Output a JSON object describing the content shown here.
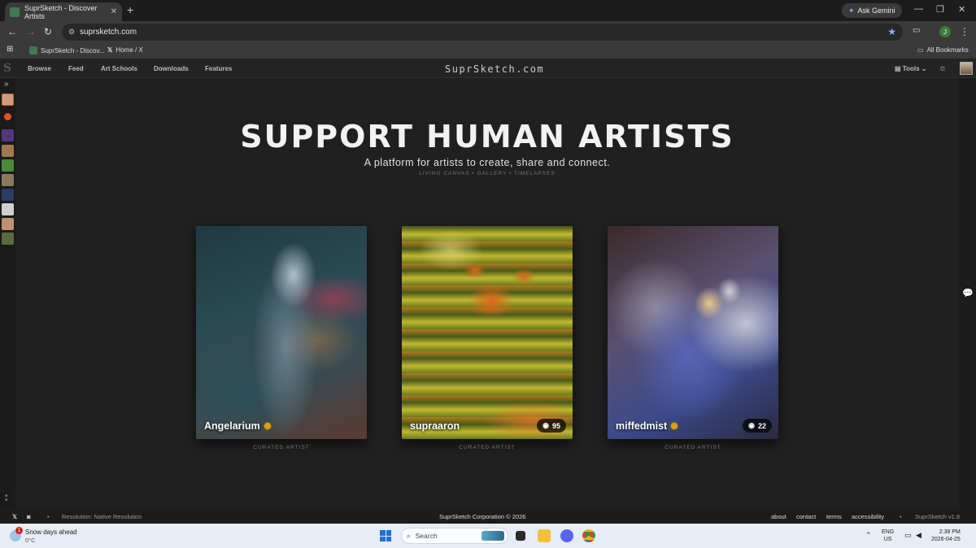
{
  "browser": {
    "tab_title": "SuprSketch - Discover Artists",
    "tab_close": "✕",
    "new_tab": "+",
    "ask_gemini": "Ask Gemini",
    "url": "suprsketch.com",
    "profile_initial": "J",
    "bookmarks": [
      {
        "label": "SuprSketch - Discov..."
      },
      {
        "label": "Home / X"
      }
    ],
    "all_bookmarks": "All Bookmarks"
  },
  "site_nav": {
    "links": [
      "Browse",
      "Feed",
      "Art Schools",
      "Downloads",
      "Features"
    ],
    "brand": "SuprSketch.com",
    "tools": "Tools"
  },
  "hero": {
    "title": "SUPPORT HUMAN ARTISTS",
    "subtitle": "A platform for artists to create, share and connect.",
    "links": "LIVING CANVAS  •  GALLERY  •  TIMELAPSES"
  },
  "cards": [
    {
      "name": "Angelarium",
      "verified": true,
      "views": null,
      "caption": "CURATED ARTIST"
    },
    {
      "name": "supraaron",
      "verified": false,
      "views": "95",
      "caption": "CURATED ARTIST"
    },
    {
      "name": "miffedmist",
      "verified": true,
      "views": "22",
      "caption": "CURATED ARTIST"
    }
  ],
  "footer": {
    "resolution": "Resolution: Native Resolution",
    "copyright": "SuprSketch Corporation © 2026",
    "links": [
      "about",
      "contact",
      "terms",
      "accessibility"
    ],
    "version": "SuprSketch v1.8"
  },
  "taskbar": {
    "weather_badge": "1",
    "weather_title": "Snow days ahead",
    "weather_temp": "0°C",
    "search_placeholder": "Search",
    "lang_top": "ENG",
    "lang_bottom": "US",
    "time": "2:38 PM",
    "date": "2026-04-25"
  },
  "colors": {
    "accent_chrome_star": "#8ab4f8",
    "verified_badge": "#d4a020",
    "rail_more": "#d46a2a"
  }
}
